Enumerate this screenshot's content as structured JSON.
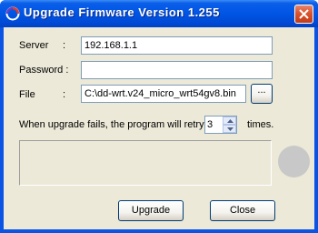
{
  "window": {
    "title": "Upgrade Firmware Version 1.255"
  },
  "form": {
    "server_label": "Server",
    "server_colon": ":",
    "server_value": "192.168.1.1",
    "password_label": "Password :",
    "password_value": "",
    "file_label": "File",
    "file_colon": ":",
    "file_value": "C:\\dd-wrt.v24_micro_wrt54gv8.bin",
    "browse_label": "..."
  },
  "retry": {
    "text_before": "When upgrade fails, the program will retry",
    "value": "3",
    "text_after": "times."
  },
  "buttons": {
    "upgrade": "Upgrade",
    "close": "Close"
  },
  "colors": {
    "titlebar": "#0055e5",
    "client_bg": "#ece9d8",
    "close_button": "#d9542f",
    "indicator": "#c8c8c8"
  }
}
